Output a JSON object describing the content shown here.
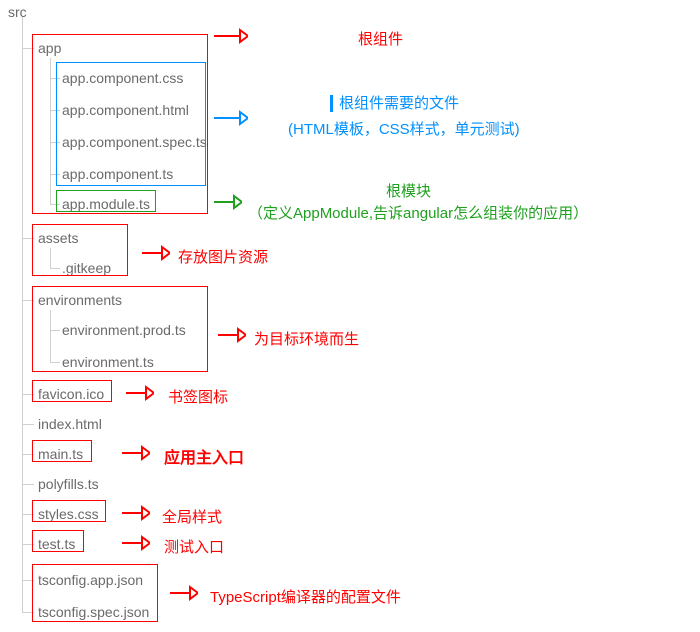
{
  "tree": {
    "root": "src",
    "app": "app",
    "app_children": {
      "css": "app.component.css",
      "html": "app.component.html",
      "spec": "app.component.spec.ts",
      "ts": "app.component.ts",
      "module": "app.module.ts"
    },
    "assets": "assets",
    "assets_children": {
      "gitkeep": ".gitkeep"
    },
    "environments": "environments",
    "env_children": {
      "prod": "environment.prod.ts",
      "env": "environment.ts"
    },
    "favicon": "favicon.ico",
    "index": "index.html",
    "main": "main.ts",
    "polyfills": "polyfills.ts",
    "styles": "styles.css",
    "test": "test.ts",
    "tsconfig_app": "tsconfig.app.json",
    "tsconfig_spec": "tsconfig.spec.json"
  },
  "notes": {
    "root_component": "根组件",
    "root_component_files_1": "根组件需要的文件",
    "root_component_files_2": "(HTML模板，CSS样式，单元测试)",
    "root_module_1": "根模块",
    "root_module_2": "（定义AppModule,告诉angular怎么组装你的应用）",
    "assets": "存放图片资源",
    "environments": "为目标环境而生",
    "favicon": "书签图标",
    "main": "应用主入口",
    "styles": "全局样式",
    "test": "测试入口",
    "tsconfig": "TypeScript编译器的配置文件"
  },
  "colors": {
    "red": "#ff0000",
    "green": "#1fa01f",
    "blue": "#0090ff"
  }
}
